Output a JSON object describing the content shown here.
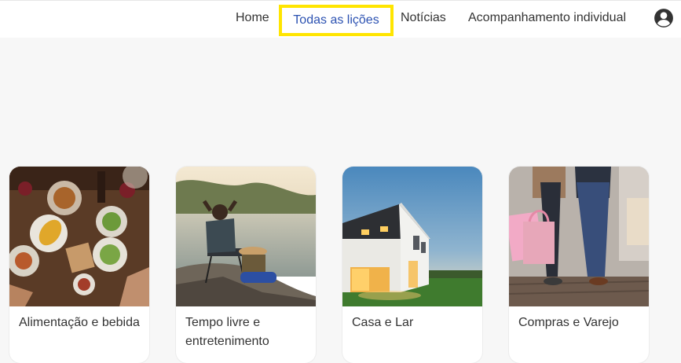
{
  "nav": {
    "home": "Home",
    "all_lessons": "Todas as lições",
    "news": "Notícias",
    "coaching": "Acompanhamento individual",
    "account_icon": "account-circle-icon",
    "active_color": "#2b51b1",
    "highlight_color": "#ffe500"
  },
  "categories": [
    {
      "label": "Alimentação e bebida",
      "image": "food-table-photo"
    },
    {
      "label": "Tempo livre e entretenimento",
      "image": "lake-relaxing-photo"
    },
    {
      "label": "Casa e Lar",
      "image": "house-at-dusk-photo"
    },
    {
      "label": "Compras e Varejo",
      "image": "shopping-bags-photo"
    }
  ]
}
